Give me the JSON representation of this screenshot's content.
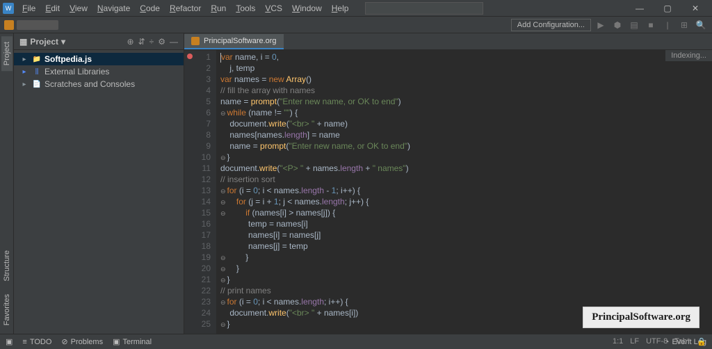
{
  "menu": [
    "File",
    "Edit",
    "View",
    "Navigate",
    "Code",
    "Refactor",
    "Run",
    "Tools",
    "VCS",
    "Window",
    "Help"
  ],
  "toolbar": {
    "add_config": "Add Configuration..."
  },
  "gutter": {
    "project": "Project",
    "structure": "Structure",
    "favorites": "Favorites"
  },
  "project_panel": {
    "title": "Project",
    "items": [
      {
        "label": "Softpedia.js",
        "sel": true
      },
      {
        "label": "External Libraries",
        "sel": false
      },
      {
        "label": "Scratches and Consoles",
        "sel": false
      }
    ]
  },
  "tab": {
    "name": "PrincipalSoftware.org"
  },
  "indexing": "Indexing...",
  "code_lines": [
    {
      "n": 1,
      "bp": true,
      "tokens": [
        [
          "kw",
          "var"
        ],
        [
          "",
          " name, i = "
        ],
        [
          "num",
          "0"
        ],
        [
          "",
          ","
        ]
      ]
    },
    {
      "n": 2,
      "tokens": [
        [
          "",
          "    j, temp"
        ]
      ]
    },
    {
      "n": 3,
      "tokens": [
        [
          "kw",
          "var"
        ],
        [
          "",
          " names = "
        ],
        [
          "kw",
          "new"
        ],
        [
          "",
          " "
        ],
        [
          "fn",
          "Array"
        ],
        [
          "",
          "()"
        ]
      ]
    },
    {
      "n": 4,
      "tokens": [
        [
          "cmt",
          "// fill the array with names"
        ]
      ]
    },
    {
      "n": 5,
      "tokens": [
        [
          "",
          "name = "
        ],
        [
          "fn",
          "prompt"
        ],
        [
          "",
          "("
        ],
        [
          "str",
          "\"Enter new name, or OK to end\""
        ],
        [
          "",
          ")"
        ]
      ]
    },
    {
      "n": 6,
      "fold": true,
      "tokens": [
        [
          "kw",
          "while"
        ],
        [
          "",
          " (name != "
        ],
        [
          "str",
          "\"\""
        ],
        [
          "",
          ") {"
        ]
      ]
    },
    {
      "n": 7,
      "tokens": [
        [
          "",
          "    document."
        ],
        [
          "fn",
          "write"
        ],
        [
          "",
          "("
        ],
        [
          "str",
          "\"<br> \""
        ],
        [
          "",
          " + name)"
        ]
      ]
    },
    {
      "n": 8,
      "tokens": [
        [
          "",
          "    names[names."
        ],
        [
          "id",
          "length"
        ],
        [
          "",
          "] = name"
        ]
      ]
    },
    {
      "n": 9,
      "tokens": [
        [
          "",
          "    name = "
        ],
        [
          "fn",
          "prompt"
        ],
        [
          "",
          "("
        ],
        [
          "str",
          "\"Enter new name, or OK to end\""
        ],
        [
          "",
          ")"
        ]
      ]
    },
    {
      "n": 10,
      "fold": true,
      "tokens": [
        [
          "",
          "}"
        ]
      ]
    },
    {
      "n": 11,
      "tokens": [
        [
          "",
          "document."
        ],
        [
          "fn",
          "write"
        ],
        [
          "",
          "("
        ],
        [
          "str",
          "\"<P> \""
        ],
        [
          "",
          " + names."
        ],
        [
          "id",
          "length"
        ],
        [
          "",
          " + "
        ],
        [
          "str",
          "\" names\""
        ],
        [
          "",
          ")"
        ]
      ]
    },
    {
      "n": 12,
      "tokens": [
        [
          "cmt",
          "// insertion sort"
        ]
      ]
    },
    {
      "n": 13,
      "fold": true,
      "tokens": [
        [
          "kw",
          "for"
        ],
        [
          "",
          " (i = "
        ],
        [
          "num",
          "0"
        ],
        [
          "",
          "; i < names."
        ],
        [
          "id",
          "length"
        ],
        [
          "",
          " - "
        ],
        [
          "num",
          "1"
        ],
        [
          "",
          "; i++) {"
        ]
      ]
    },
    {
      "n": 14,
      "fold": true,
      "tokens": [
        [
          "",
          "    "
        ],
        [
          "kw",
          "for"
        ],
        [
          "",
          " (j = i + "
        ],
        [
          "num",
          "1"
        ],
        [
          "",
          "; j < names."
        ],
        [
          "id",
          "length"
        ],
        [
          "",
          "; j++) {"
        ]
      ]
    },
    {
      "n": 15,
      "fold": true,
      "tokens": [
        [
          "",
          "        "
        ],
        [
          "kw",
          "if"
        ],
        [
          "",
          " (names[i] > names[j]) {"
        ]
      ]
    },
    {
      "n": 16,
      "tokens": [
        [
          "",
          "            temp = names[i]"
        ]
      ]
    },
    {
      "n": 17,
      "tokens": [
        [
          "",
          "            names[i] = names[j]"
        ]
      ]
    },
    {
      "n": 18,
      "tokens": [
        [
          "",
          "            names[j] = temp"
        ]
      ]
    },
    {
      "n": 19,
      "fold": true,
      "tokens": [
        [
          "",
          "        }"
        ]
      ]
    },
    {
      "n": 20,
      "fold": true,
      "tokens": [
        [
          "",
          "    }"
        ]
      ]
    },
    {
      "n": 21,
      "fold": true,
      "tokens": [
        [
          "",
          "}"
        ]
      ]
    },
    {
      "n": 22,
      "tokens": [
        [
          "cmt",
          "// print names"
        ]
      ]
    },
    {
      "n": 23,
      "fold": true,
      "tokens": [
        [
          "kw",
          "for"
        ],
        [
          "",
          " (i = "
        ],
        [
          "num",
          "0"
        ],
        [
          "",
          "; i < names."
        ],
        [
          "id",
          "length"
        ],
        [
          "",
          "; i++) {"
        ]
      ]
    },
    {
      "n": 24,
      "tokens": [
        [
          "",
          "    document."
        ],
        [
          "fn",
          "write"
        ],
        [
          "",
          "("
        ],
        [
          "str",
          "\"<br> \""
        ],
        [
          "",
          " + names[i])"
        ]
      ]
    },
    {
      "n": 25,
      "fold": true,
      "tokens": [
        [
          "",
          "}"
        ]
      ]
    }
  ],
  "bottombar": {
    "left": [
      {
        "icon": "≡",
        "label": "TODO"
      },
      {
        "icon": "⊘",
        "label": "Problems"
      },
      {
        "icon": "▣",
        "label": "Terminal"
      }
    ],
    "event_log": "Event Log",
    "status": [
      "1:1",
      "LF",
      "UTF-8",
      "Tab*"
    ]
  },
  "watermark": "PrincipalSoftware.org"
}
